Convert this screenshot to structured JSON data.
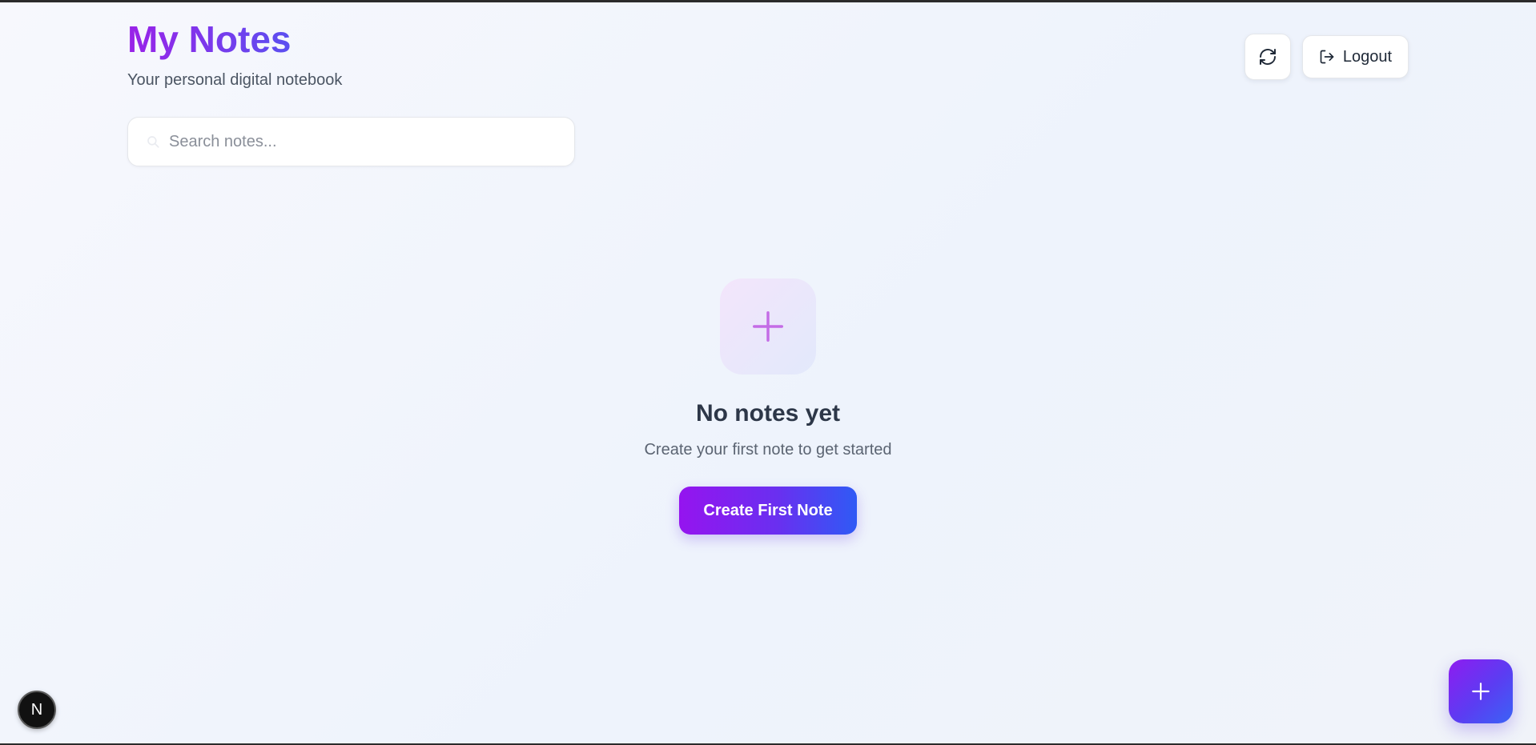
{
  "header": {
    "title": "My Notes",
    "subtitle": "Your personal digital notebook"
  },
  "search": {
    "placeholder": "Search notes...",
    "value": "",
    "icon": "search-icon"
  },
  "toolbar": {
    "refresh_icon": "refresh-icon",
    "logout_icon": "logout-icon",
    "logout_label": "Logout"
  },
  "empty_state": {
    "icon": "plus-icon",
    "title": "No notes yet",
    "subtitle": "Create your first note to get started",
    "cta_label": "Create First Note"
  },
  "fab": {
    "icon": "plus-icon"
  },
  "dev_badge": {
    "label": "N"
  },
  "colors": {
    "accent_purple": "#9514ef",
    "accent_blue": "#2f5af5",
    "empty_icon": "#c46ce6",
    "heading": "#2d3748"
  }
}
